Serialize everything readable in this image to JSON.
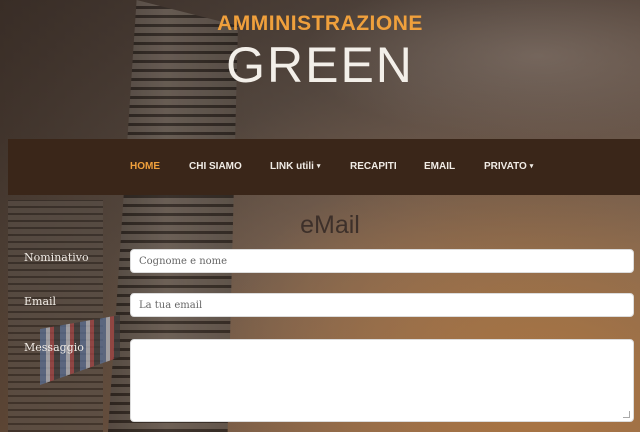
{
  "brand": {
    "top": "AMMINISTRAZIONE",
    "main": "GREEN",
    "accent_color": "#f0a03c"
  },
  "nav": {
    "items": [
      {
        "label": "HOME",
        "active": true,
        "dropdown": false
      },
      {
        "label": "CHI SIAMO",
        "active": false,
        "dropdown": false
      },
      {
        "label": "LINK utili",
        "active": false,
        "dropdown": true
      },
      {
        "label": "RECAPITI",
        "active": false,
        "dropdown": false
      },
      {
        "label": "EMAIL",
        "active": false,
        "dropdown": false
      },
      {
        "label": "PRIVATO",
        "active": false,
        "dropdown": true
      }
    ],
    "caret": "▾"
  },
  "form": {
    "title": "eMail",
    "fields": [
      {
        "label": "Nominativo",
        "placeholder": "Cognome e nome",
        "value": ""
      },
      {
        "label": "Email",
        "placeholder": "La tua email",
        "value": ""
      },
      {
        "label": "Messaggio",
        "placeholder": "",
        "value": ""
      }
    ]
  }
}
